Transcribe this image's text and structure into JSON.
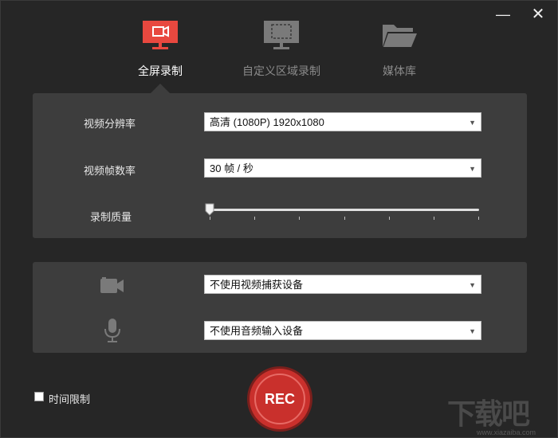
{
  "window": {
    "minimize_glyph": "—",
    "close_glyph": "✕"
  },
  "tabs": [
    {
      "label": "全屏录制",
      "icon": "monitor-record-icon",
      "active": true
    },
    {
      "label": "自定义区域录制",
      "icon": "monitor-region-icon",
      "active": false
    },
    {
      "label": "媒体库",
      "icon": "folder-icon",
      "active": false
    }
  ],
  "settings": {
    "resolution": {
      "label": "视频分辨率",
      "value": "高清 (1080P)   1920x1080"
    },
    "framerate": {
      "label": "视频帧数率",
      "value": "30 帧 / 秒"
    },
    "quality": {
      "label": "录制质量",
      "level": 0,
      "steps": 7
    }
  },
  "devices": {
    "camera": {
      "icon": "camera-icon",
      "value": "不使用视频捕获设备"
    },
    "microphone": {
      "icon": "microphone-icon",
      "value": "不使用音频输入设备"
    }
  },
  "rec_button": {
    "label": "REC"
  },
  "time_limit": {
    "label": "时间限制",
    "checked": false
  },
  "watermark": {
    "text": "下载吧",
    "sub": "www.xiazaiba.com"
  },
  "colors": {
    "accent": "#e8483f",
    "rec": "#c9302c",
    "panel": "#3d3d3d",
    "background": "#262626"
  }
}
